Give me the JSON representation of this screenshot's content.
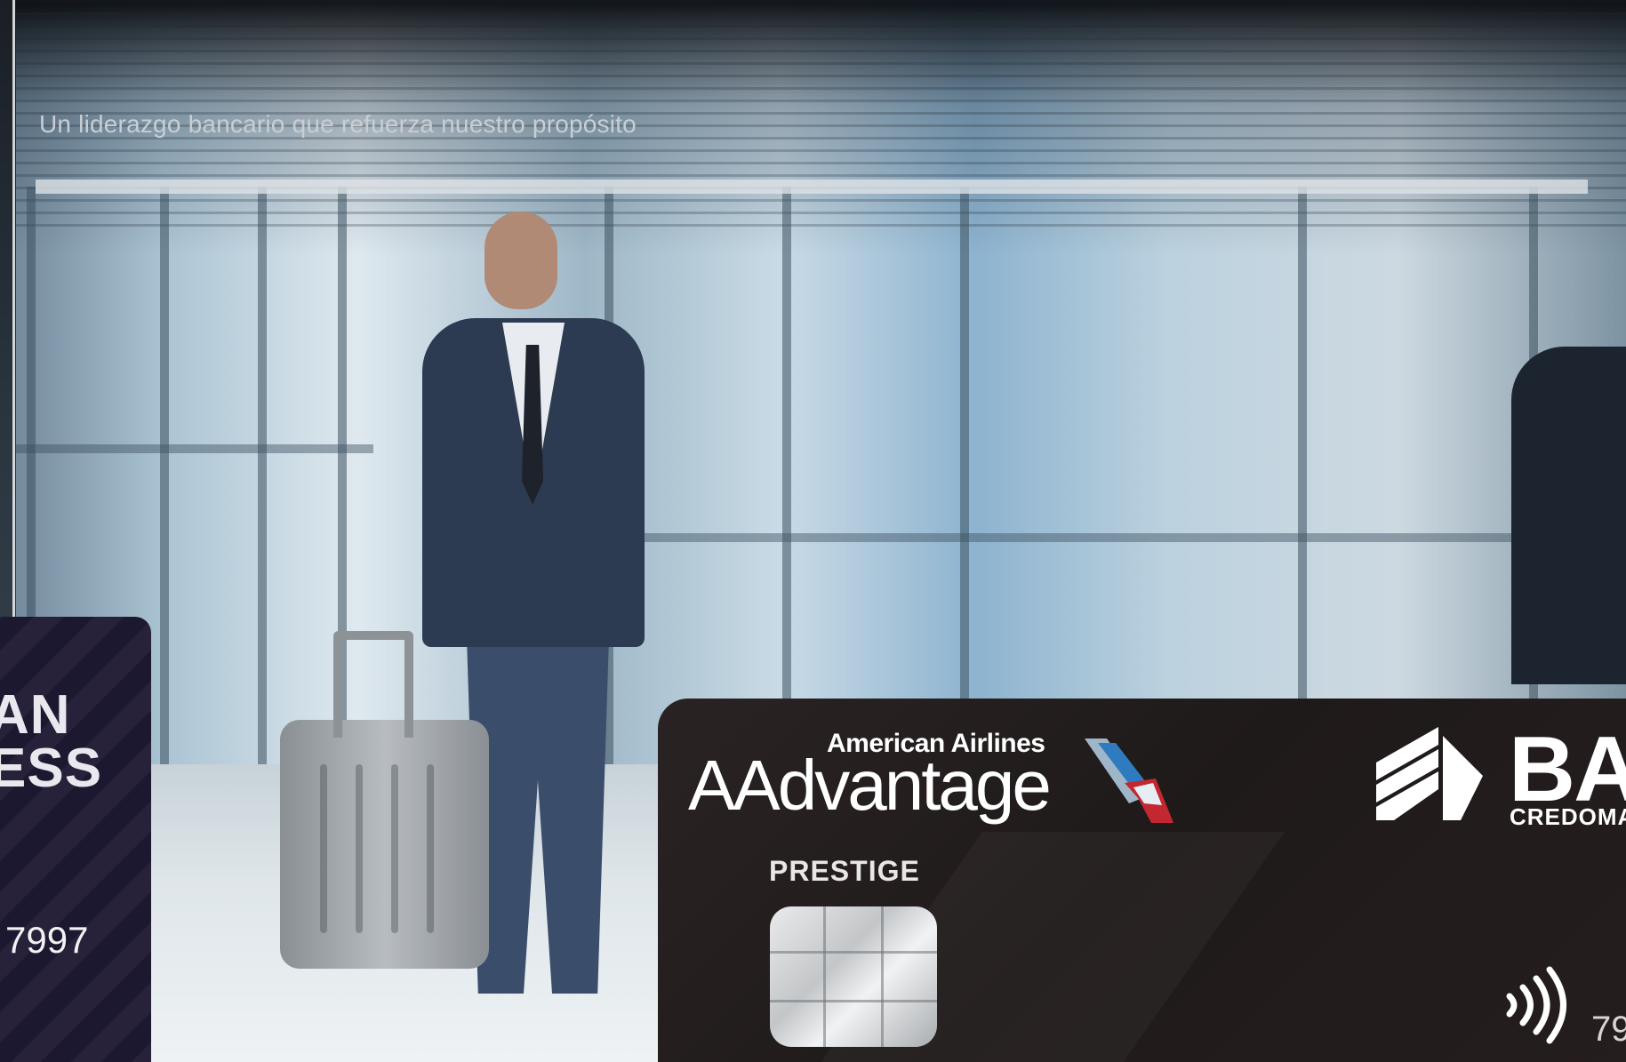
{
  "hero": {
    "title": "Un liderazgo bancario que refuerza nuestro propósito",
    "progress_percent": 100
  },
  "card_left": {
    "brand_line1": "AN",
    "brand_line2": "ESS",
    "digits": "7997"
  },
  "card_right": {
    "airline": "American Airlines",
    "program": "AAdvantage",
    "tier": "PRESTIGE",
    "bank_name": "BA",
    "bank_sub": "CREDOMA",
    "card_digits": "79",
    "contactless_icon": "contactless-icon",
    "chip_icon": "chip-icon",
    "airline_logo_icon": "american-airlines-logo-icon",
    "bank_logo_icon": "bank-logo-icon"
  },
  "colors": {
    "title_text": "#c8ced3",
    "progress_track": "#cdd4d9",
    "card_right_bg": "#221c1c",
    "aa_red": "#c3272f",
    "aa_blue": "#2f7bbf"
  }
}
